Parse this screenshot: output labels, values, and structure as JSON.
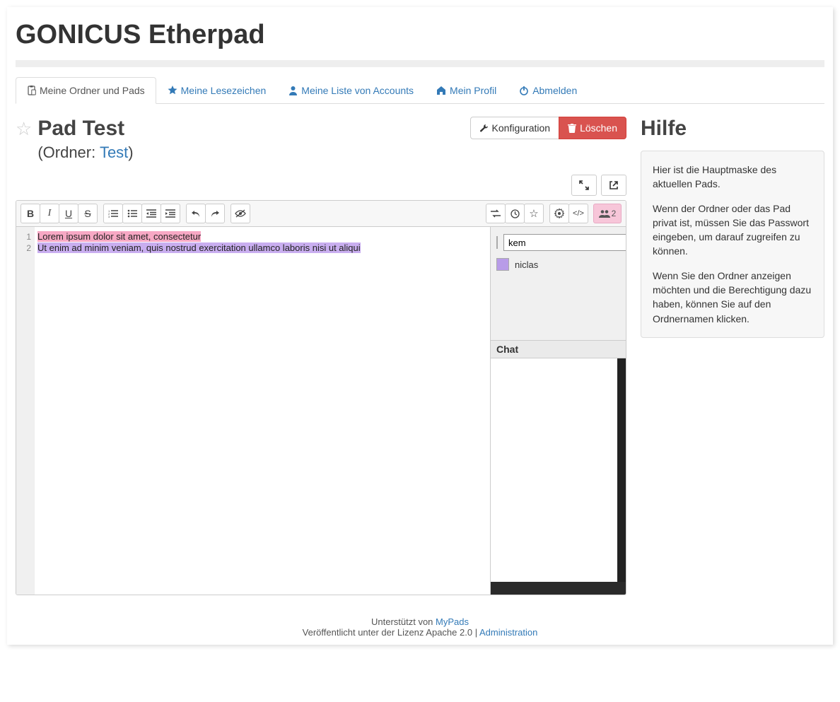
{
  "site_title": "GONICUS Etherpad",
  "nav": [
    {
      "label": "Meine Ordner und Pads"
    },
    {
      "label": "Meine Lesezeichen"
    },
    {
      "label": "Meine Liste von Accounts"
    },
    {
      "label": "Mein Profil"
    },
    {
      "label": "Abmelden"
    }
  ],
  "pad": {
    "title": "Pad Test",
    "folder_prefix": "(Ordner: ",
    "folder_name": "Test",
    "folder_suffix": ")"
  },
  "actions": {
    "config": "Konfiguration",
    "delete": "Löschen"
  },
  "editor": {
    "line1_num": "1",
    "line2_num": "2",
    "line1": "Lorem ipsum dolor sit amet, consectetur",
    "line2": "Ut enim ad minim veniam, quis nostrud exercitation ullamco laboris nisi ut aliqui",
    "user_count": "2",
    "users": [
      {
        "name": "kem",
        "color": "pink"
      },
      {
        "name": "niclas",
        "color": "purple"
      }
    ],
    "chat_label": "Chat"
  },
  "help": {
    "title": "Hilfe",
    "p1": "Hier ist die Hauptmaske des aktuellen Pads.",
    "p2": "Wenn der Ordner oder das Pad privat ist, müssen Sie das Passwort eingeben, um darauf zugreifen zu können.",
    "p3": "Wenn Sie den Ordner anzeigen möchten und die Berechtigung dazu haben, können Sie auf den Ordnernamen klicken."
  },
  "footer": {
    "supported": "Unterstützt von ",
    "mypads": "MyPads",
    "license": "Veröffentlicht unter der Lizenz Apache 2.0 | ",
    "admin": "Administration"
  }
}
